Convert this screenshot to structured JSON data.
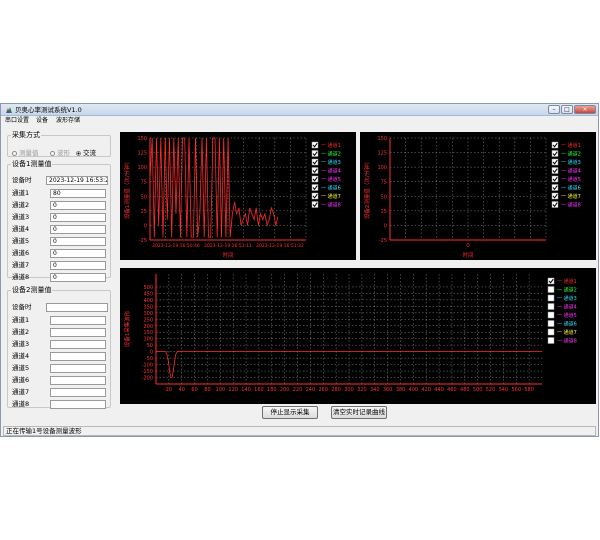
{
  "window": {
    "title": "贝奥心率测试系统V1.0",
    "controls": [
      "–",
      "□",
      "×"
    ]
  },
  "menu": [
    "串口设置",
    "设备",
    "波形存储"
  ],
  "acquisition": {
    "legend": "采集方式",
    "options": [
      {
        "label": "测量值",
        "selected": false,
        "enabled": false
      },
      {
        "label": "波形",
        "selected": false,
        "enabled": false
      },
      {
        "label": "交流",
        "selected": true,
        "enabled": true
      }
    ]
  },
  "device1": {
    "legend": "设备1测量值",
    "time_label": "设备时",
    "time_value": "2023-12-19 16:53:24",
    "channels": [
      {
        "label": "通道1",
        "value": "80"
      },
      {
        "label": "通道2",
        "value": "0"
      },
      {
        "label": "通道3",
        "value": "0"
      },
      {
        "label": "通道4",
        "value": "0"
      },
      {
        "label": "通道5",
        "value": "0"
      },
      {
        "label": "通道6",
        "value": "0"
      },
      {
        "label": "通道7",
        "value": "0"
      },
      {
        "label": "通道8",
        "value": "0"
      }
    ]
  },
  "device2": {
    "legend": "设备2测量值",
    "time_label": "设备时",
    "channels": [
      "通道1",
      "通道2",
      "通道3",
      "通道4",
      "通道5",
      "通道6",
      "通道7",
      "通道8"
    ]
  },
  "legend_items": [
    {
      "label": "一 通道1",
      "color": "#ff2a2a"
    },
    {
      "label": "一 通道2",
      "color": "#33ff33"
    },
    {
      "label": "一 通道3",
      "color": "#33e0ff"
    },
    {
      "label": "一 通道4",
      "color": "#ff33ff"
    },
    {
      "label": "一 通道5",
      "color": "#ff33ff"
    },
    {
      "label": "一 通道6",
      "color": "#33e0ff"
    },
    {
      "label": "一 通道7",
      "color": "#ffff33"
    },
    {
      "label": "一 通道8",
      "color": "#ff33ff"
    }
  ],
  "chart_data": [
    {
      "id": "chart1",
      "type": "line",
      "ylabel": "设备1测量值（次/分钟）",
      "xlabel": "时间",
      "ylim": [
        -25,
        150
      ],
      "yticks": [
        -25,
        0,
        25,
        50,
        75,
        100,
        125,
        150
      ],
      "ytick_labels": [
        "-25",
        "0",
        "25",
        "50",
        "75",
        "100",
        "125",
        "150"
      ],
      "xticks": [
        "2023-12-19 16:50:46",
        "2023-12-19 16:51:11",
        "2023-12-19 16:51:32"
      ],
      "grid": true,
      "legend_checked": [
        true,
        true,
        true,
        true,
        true,
        true,
        true,
        true
      ],
      "series": [
        {
          "legend_index": 0,
          "values": [
            80,
            150,
            -20,
            150,
            0,
            150,
            -20,
            150,
            10,
            150,
            -20,
            150,
            20,
            150,
            -20,
            150,
            150,
            -20,
            150,
            -20,
            -20,
            150,
            -20,
            20,
            150,
            -20,
            150,
            -20,
            -20,
            150,
            150,
            -20,
            150,
            -20,
            150,
            -20,
            150,
            -20,
            20,
            40,
            20,
            30,
            0,
            10,
            20,
            0,
            30,
            20,
            10,
            30,
            0,
            20,
            10,
            20,
            0,
            10,
            30,
            20,
            0,
            15
          ]
        }
      ]
    },
    {
      "id": "chart2",
      "type": "line",
      "ylabel": "设备2测量值（次/分钟）",
      "xlabel": "时间",
      "ylim": [
        -25,
        150
      ],
      "yticks": [
        -25,
        0,
        25,
        50,
        75,
        100,
        125,
        150
      ],
      "ytick_labels": [
        "-25",
        "0",
        "25",
        "50",
        "75",
        "100",
        "125",
        "150"
      ],
      "xticks": [
        "0"
      ],
      "grid": true,
      "legend_checked": [
        true,
        true,
        true,
        true,
        true,
        true,
        true,
        true
      ],
      "series": []
    },
    {
      "id": "chart3",
      "type": "line",
      "ylabel": "设备1采集波形",
      "xlabel": "",
      "ylim": [
        -250,
        600
      ],
      "yticks": [
        -200,
        -150,
        -100,
        -50,
        0,
        50,
        100,
        150,
        200,
        250,
        300,
        350,
        400,
        450,
        500
      ],
      "ytick_labels": [
        "-200",
        "-150",
        "-100",
        "-50",
        "0",
        "50",
        "100",
        "150",
        "200",
        "250",
        "300",
        "350",
        "400",
        "450",
        "500"
      ],
      "xlim": [
        0,
        600
      ],
      "xticks": [
        20,
        40,
        60,
        80,
        100,
        120,
        140,
        160,
        180,
        200,
        220,
        240,
        260,
        280,
        300,
        320,
        340,
        360,
        380,
        400,
        420,
        440,
        460,
        480,
        500,
        520,
        540,
        560,
        580
      ],
      "grid": true,
      "legend_checked": [
        true,
        false,
        false,
        false,
        false,
        false,
        false,
        false
      ],
      "series": [
        {
          "legend_index": 0,
          "x": [
            0,
            15,
            17,
            19,
            21,
            23,
            25,
            27,
            29,
            31,
            33,
            35,
            37,
            39,
            41,
            43,
            45,
            63,
            65,
            67,
            69,
            71,
            73,
            75,
            77,
            79,
            81,
            83,
            85,
            87,
            89,
            91,
            93,
            111,
            113,
            115,
            117,
            119,
            121,
            123,
            125,
            127,
            129,
            131,
            133,
            135,
            137,
            139,
            141,
            159,
            161,
            163,
            165,
            167,
            169,
            171,
            173,
            175,
            177,
            179,
            181,
            183,
            185,
            187,
            189,
            207,
            209,
            211,
            213,
            215,
            217,
            219,
            221,
            223,
            225,
            227,
            229,
            231,
            233,
            235,
            237,
            255,
            257,
            259,
            261,
            263,
            265,
            267,
            269,
            271,
            273,
            275,
            277,
            279,
            281,
            283,
            285,
            303,
            305,
            307,
            309,
            311,
            313,
            315,
            317,
            319,
            321,
            323,
            325,
            327,
            329,
            331,
            333,
            351,
            353,
            355,
            357,
            359,
            361,
            363,
            365,
            367,
            369,
            371,
            373,
            375,
            377,
            379,
            381,
            399,
            401,
            403,
            405,
            407,
            409,
            411,
            413,
            415,
            417,
            419,
            421,
            423,
            425,
            427,
            429,
            447,
            449,
            451,
            453,
            455,
            457,
            459,
            461,
            463,
            465,
            467,
            469,
            471,
            473,
            475,
            477,
            495,
            497,
            499,
            501,
            503,
            505,
            507,
            509,
            511,
            513,
            515,
            517,
            519,
            521,
            523,
            525,
            543,
            545,
            547,
            549,
            551,
            553,
            555,
            557,
            559,
            561,
            563,
            565,
            567,
            569,
            571,
            573,
            591,
            593,
            595,
            597,
            599
          ],
          "values": [
            0,
            0,
            -19,
            -70,
            -141,
            -199,
            -199,
            -141,
            -70,
            -19,
            0,
            0,
            0,
            0,
            0,
            0,
            0,
            0,
            0,
            0,
            0,
            0,
            0,
            0,
            0,
            0,
            0,
            0,
            0,
            0,
            0,
            0,
            0,
            0,
            0,
            0,
            0,
            0,
            0,
            0,
            0,
            0,
            0,
            0,
            0,
            0,
            0,
            0,
            0,
            0,
            0,
            0,
            0,
            0,
            0,
            0,
            0,
            0,
            0,
            0,
            0,
            0,
            0,
            0,
            0,
            0,
            0,
            0,
            0,
            0,
            0,
            0,
            0,
            0,
            0,
            0,
            0,
            0,
            0,
            0,
            0,
            0,
            0,
            0,
            0,
            0,
            0,
            0,
            0,
            0,
            0,
            0,
            0,
            0,
            0,
            0,
            0,
            0,
            0,
            0,
            0,
            0,
            0,
            0,
            0,
            0,
            0,
            0,
            0,
            0,
            0,
            0,
            0,
            0,
            0,
            0,
            0,
            0,
            0,
            0,
            0,
            0,
            0,
            0,
            0,
            0,
            0,
            0,
            0,
            0,
            0,
            0,
            0,
            0,
            0,
            0,
            0,
            0,
            0,
            0,
            0,
            0,
            0,
            0,
            0,
            0,
            0,
            0,
            0,
            0,
            0,
            0,
            0,
            0,
            0,
            0,
            0,
            0,
            0,
            0,
            0,
            0,
            0,
            0,
            0,
            0,
            0,
            0,
            0,
            0,
            0,
            0,
            0,
            0,
            0,
            0,
            0,
            0,
            0,
            0,
            0,
            0,
            0,
            0,
            0,
            0,
            0,
            0,
            0,
            0,
            0,
            0,
            0,
            0,
            0,
            0,
            0,
            0
          ]
        }
      ]
    }
  ],
  "buttons": {
    "stop": "停止显示采集",
    "clear": "清空实时记录曲线"
  },
  "status": "正在传输1号设备测量波形"
}
